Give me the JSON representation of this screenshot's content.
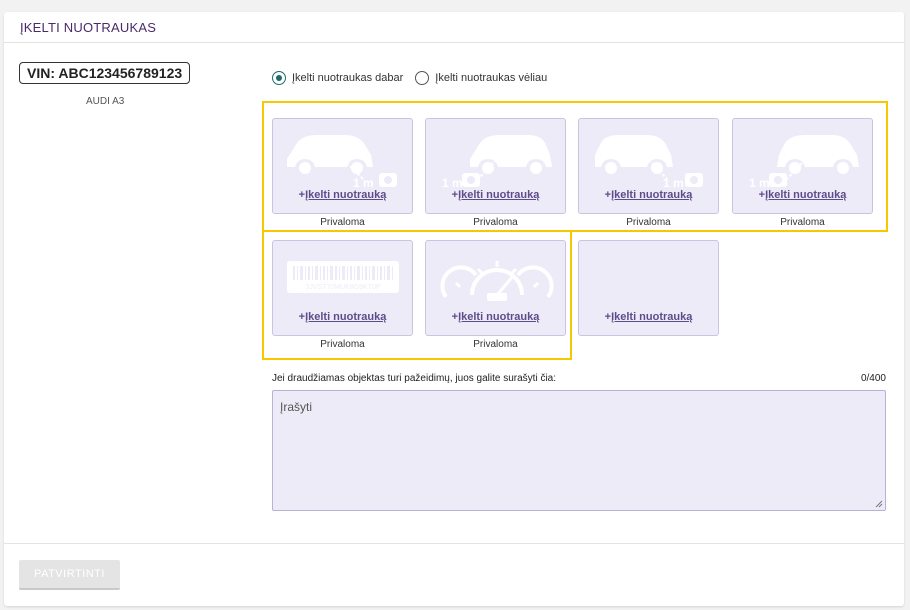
{
  "header": {
    "title": "ĮKELTI NUOTRAUKAS"
  },
  "vehicle": {
    "vin_label": "VIN: ABC123456789123",
    "model": "AUDI A3"
  },
  "upload_mode": {
    "options": [
      {
        "label": "Įkelti nuotraukas dabar",
        "selected": true
      },
      {
        "label": "Įkelti nuotraukas vėliau",
        "selected": false
      }
    ]
  },
  "photo_slots": [
    {
      "icon": "car-front-left-icon",
      "distance": "1 m",
      "link_prefix": "+",
      "link_text": "Įkelti nuotrauką",
      "required": "Privaloma"
    },
    {
      "icon": "car-rear-left-icon",
      "distance": "1 m",
      "link_prefix": "+",
      "link_text": "Įkelti nuotrauką",
      "required": "Privaloma"
    },
    {
      "icon": "car-rear-right-icon",
      "distance": "1 m",
      "link_prefix": "+",
      "link_text": "Įkelti nuotrauką",
      "required": "Privaloma"
    },
    {
      "icon": "car-front-right-icon",
      "distance": "1 m",
      "link_prefix": "+",
      "link_text": "Įkelti nuotrauką",
      "required": "Privaloma"
    },
    {
      "icon": "vin-barcode-icon",
      "barcode_text": "3JVST70MUK8G9KT0P",
      "link_prefix": "+",
      "link_text": "Įkelti nuotrauką",
      "required": "Privaloma"
    },
    {
      "icon": "odometer-icon",
      "link_prefix": "+",
      "link_text": "Įkelti nuotrauką",
      "required": "Privaloma"
    },
    {
      "icon": "",
      "link_prefix": "+",
      "link_text": "Įkelti nuotrauką",
      "required": ""
    }
  ],
  "notes": {
    "label": "Jei draudžiamas objektas turi pažeidimų, juos galite surašyti čia:",
    "counter": "0/400",
    "placeholder": "Įrašyti"
  },
  "footer": {
    "confirm_label": "PATVIRTINTI"
  },
  "colors": {
    "accent": "#1e6b6b",
    "tile_bg": "#eeebf8",
    "link": "#5e4c8a",
    "highlight": "#f5c800",
    "header_text": "#4a2a6a"
  }
}
